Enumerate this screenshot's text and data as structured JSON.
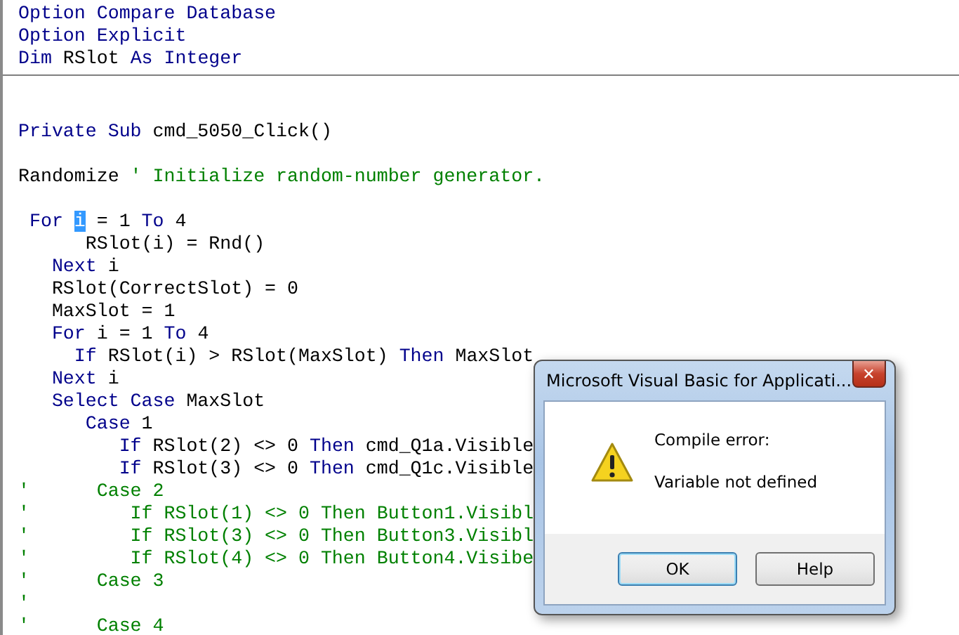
{
  "declarations": [
    {
      "segments": [
        {
          "kind": "keyword",
          "text": "Option Compare Database"
        }
      ]
    },
    {
      "segments": [
        {
          "kind": "keyword",
          "text": "Option Explicit"
        }
      ]
    },
    {
      "segments": [
        {
          "kind": "keyword",
          "text": "Dim "
        },
        {
          "kind": "plain",
          "text": "RSlot "
        },
        {
          "kind": "keyword",
          "text": "As Integer"
        }
      ]
    }
  ],
  "procedure": [
    {
      "kind": "blank"
    },
    {
      "kind": "blank"
    },
    {
      "segments": [
        {
          "kind": "keyword",
          "text": "Private Sub "
        },
        {
          "kind": "plain",
          "text": "cmd_5050_Click()"
        }
      ]
    },
    {
      "kind": "blank"
    },
    {
      "segments": [
        {
          "kind": "plain",
          "text": "Randomize "
        },
        {
          "kind": "comment",
          "text": "' Initialize random-number generator."
        }
      ]
    },
    {
      "kind": "blank"
    },
    {
      "segments": [
        {
          "kind": "keyword",
          "text": " For "
        },
        {
          "kind": "selection",
          "text": "i"
        },
        {
          "kind": "plain",
          "text": " = 1 "
        },
        {
          "kind": "keyword",
          "text": "To"
        },
        {
          "kind": "plain",
          "text": " 4"
        }
      ]
    },
    {
      "segments": [
        {
          "kind": "plain",
          "text": "      RSlot(i) = Rnd()"
        }
      ]
    },
    {
      "segments": [
        {
          "kind": "keyword",
          "text": "   Next"
        },
        {
          "kind": "plain",
          "text": " i"
        }
      ]
    },
    {
      "segments": [
        {
          "kind": "plain",
          "text": "   RSlot(CorrectSlot) = 0"
        }
      ]
    },
    {
      "segments": [
        {
          "kind": "plain",
          "text": "   MaxSlot = 1"
        }
      ]
    },
    {
      "segments": [
        {
          "kind": "keyword",
          "text": "   For"
        },
        {
          "kind": "plain",
          "text": " i = 1 "
        },
        {
          "kind": "keyword",
          "text": "To"
        },
        {
          "kind": "plain",
          "text": " 4"
        }
      ]
    },
    {
      "segments": [
        {
          "kind": "keyword",
          "text": "     If"
        },
        {
          "kind": "plain",
          "text": " RSlot(i) > RSlot(MaxSlot) "
        },
        {
          "kind": "keyword",
          "text": "Then"
        },
        {
          "kind": "plain",
          "text": " MaxSlot"
        }
      ]
    },
    {
      "segments": [
        {
          "kind": "keyword",
          "text": "   Next"
        },
        {
          "kind": "plain",
          "text": " i"
        }
      ]
    },
    {
      "segments": [
        {
          "kind": "keyword",
          "text": "   Select Case"
        },
        {
          "kind": "plain",
          "text": " MaxSlot"
        }
      ]
    },
    {
      "segments": [
        {
          "kind": "keyword",
          "text": "      Case"
        },
        {
          "kind": "plain",
          "text": " 1"
        }
      ]
    },
    {
      "segments": [
        {
          "kind": "keyword",
          "text": "         If"
        },
        {
          "kind": "plain",
          "text": " RSlot(2) <> 0 "
        },
        {
          "kind": "keyword",
          "text": "Then"
        },
        {
          "kind": "plain",
          "text": " cmd_Q1a.Visible"
        }
      ]
    },
    {
      "segments": [
        {
          "kind": "keyword",
          "text": "         If"
        },
        {
          "kind": "plain",
          "text": " RSlot(3) <> 0 "
        },
        {
          "kind": "keyword",
          "text": "Then"
        },
        {
          "kind": "plain",
          "text": " cmd_Q1c.Visible"
        }
      ]
    },
    {
      "segments": [
        {
          "kind": "comment",
          "text": "'      Case 2"
        }
      ]
    },
    {
      "segments": [
        {
          "kind": "comment",
          "text": "'         If RSlot(1) <> 0 Then Button1.Visibl"
        }
      ]
    },
    {
      "segments": [
        {
          "kind": "comment",
          "text": "'         If RSlot(3) <> 0 Then Button3.Visibl"
        }
      ]
    },
    {
      "segments": [
        {
          "kind": "comment",
          "text": "'         If RSlot(4) <> 0 Then Button4.Visibe"
        }
      ]
    },
    {
      "segments": [
        {
          "kind": "comment",
          "text": "'      Case 3"
        }
      ]
    },
    {
      "segments": [
        {
          "kind": "comment",
          "text": "'"
        }
      ]
    },
    {
      "segments": [
        {
          "kind": "comment",
          "text": "'      Case 4"
        }
      ]
    }
  ],
  "dialog": {
    "title": "Microsoft Visual Basic for Applicati...",
    "close": "✕",
    "message": "Compile error:",
    "detail": "Variable not defined",
    "buttons": [
      {
        "label": "OK",
        "default": true
      },
      {
        "label": "Help",
        "default": false
      }
    ]
  }
}
